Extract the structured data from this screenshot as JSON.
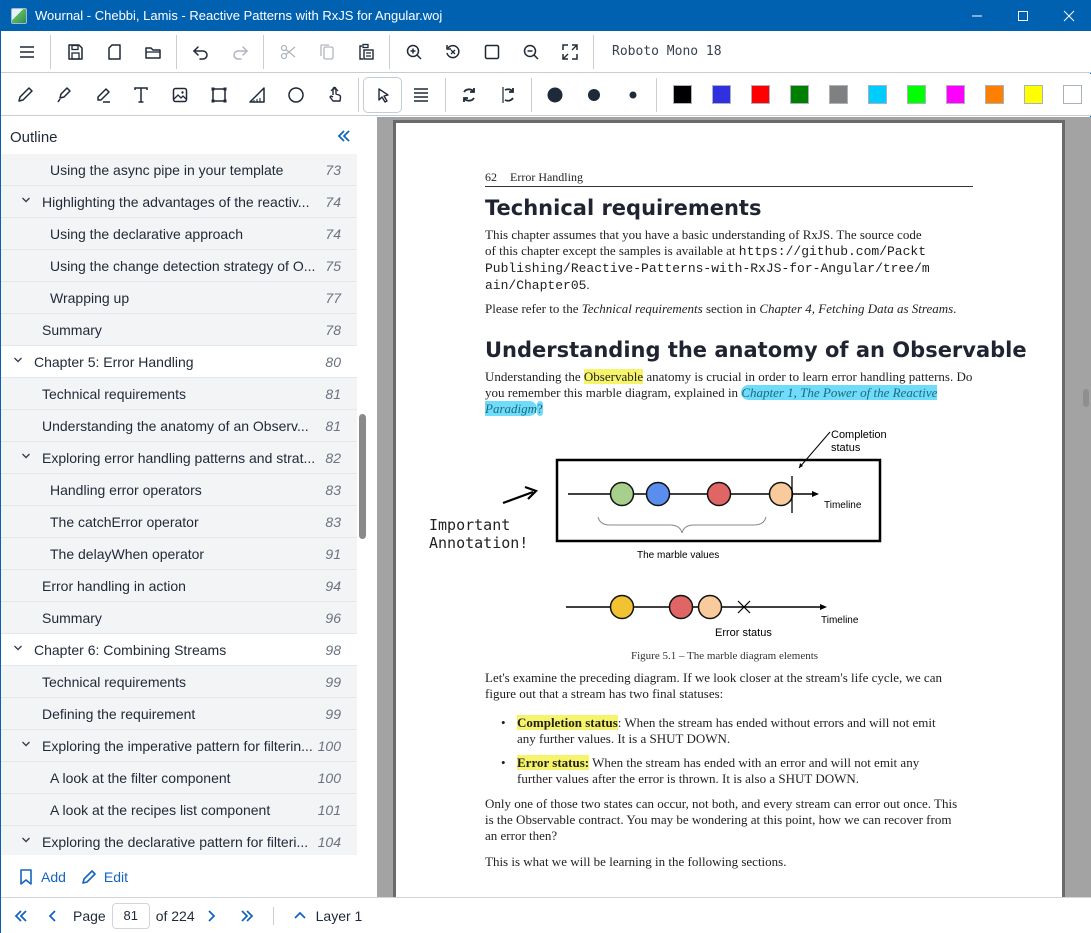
{
  "window": {
    "title": "Wournal - Chebbi, Lamis - Reactive Patterns with RxJS for Angular.woj",
    "controls": [
      "minimize",
      "maximize",
      "close"
    ]
  },
  "toolbar1": {
    "buttons": [
      "menu-icon",
      "save-icon",
      "new-page-icon",
      "open-folder-icon",
      "undo-icon",
      "redo-icon",
      "cut-icon",
      "copy-icon",
      "paste-icon",
      "zoom-in-icon",
      "reset-zoom-icon",
      "fit-page-icon",
      "zoom-out-icon",
      "fullscreen-icon"
    ],
    "font_label": "Roboto Mono 18"
  },
  "toolbar2": {
    "tools": [
      "pen",
      "highlighter",
      "eraser",
      "text",
      "image",
      "select-rectangle",
      "ruler",
      "ellipse",
      "touch-drawing",
      "select-pointer",
      "line-spacing",
      "rotate",
      "rotate-page"
    ],
    "active_tool": "select-pointer",
    "stroke_sizes": [
      "large",
      "medium",
      "small"
    ],
    "colors": [
      "#000000",
      "#3030e0",
      "#ff0000",
      "#008000",
      "#808080",
      "#00ccff",
      "#00ff00",
      "#ff00ff",
      "#ff7f00",
      "#ffff00",
      "#ffffff"
    ]
  },
  "sidebar": {
    "title": "Outline",
    "collapse_label": "«",
    "items": [
      {
        "label": "Using the async pipe in your template",
        "page": "73",
        "level": 3,
        "expandable": false
      },
      {
        "label": "Highlighting the advantages of the reactiv...",
        "page": "74",
        "level": 2,
        "expandable": true
      },
      {
        "label": "Using the declarative approach",
        "page": "74",
        "level": 3,
        "expandable": false
      },
      {
        "label": "Using the change detection strategy of O...",
        "page": "75",
        "level": 3,
        "expandable": false
      },
      {
        "label": "Wrapping up",
        "page": "77",
        "level": 3,
        "expandable": false
      },
      {
        "label": "Summary",
        "page": "78",
        "level": 2,
        "expandable": false
      },
      {
        "label": "Chapter 5: Error Handling",
        "page": "80",
        "level": 1,
        "expandable": true
      },
      {
        "label": "Technical requirements",
        "page": "81",
        "level": 2,
        "expandable": false
      },
      {
        "label": "Understanding the anatomy of an Observ...",
        "page": "81",
        "level": 2,
        "expandable": false
      },
      {
        "label": "Exploring error handling patterns and strat...",
        "page": "82",
        "level": 2,
        "expandable": true
      },
      {
        "label": "Handling error operators",
        "page": "83",
        "level": 3,
        "expandable": false
      },
      {
        "label": "The catchError operator",
        "page": "83",
        "level": 3,
        "expandable": false
      },
      {
        "label": "The delayWhen operator",
        "page": "91",
        "level": 3,
        "expandable": false
      },
      {
        "label": "Error handling in action",
        "page": "94",
        "level": 2,
        "expandable": false
      },
      {
        "label": "Summary",
        "page": "96",
        "level": 2,
        "expandable": false
      },
      {
        "label": "Chapter 6: Combining Streams",
        "page": "98",
        "level": 1,
        "expandable": true
      },
      {
        "label": "Technical requirements",
        "page": "99",
        "level": 2,
        "expandable": false
      },
      {
        "label": "Defining the requirement",
        "page": "99",
        "level": 2,
        "expandable": false
      },
      {
        "label": "Exploring the imperative pattern for filterin...",
        "page": "100",
        "level": 2,
        "expandable": true
      },
      {
        "label": "A look at the filter component",
        "page": "100",
        "level": 3,
        "expandable": false
      },
      {
        "label": "A look at the recipes list component",
        "page": "101",
        "level": 3,
        "expandable": false
      },
      {
        "label": "Exploring the declarative pattern for filteri...",
        "page": "104",
        "level": 2,
        "expandable": true
      }
    ],
    "add_label": "Add",
    "edit_label": "Edit"
  },
  "document": {
    "running_head_number": "62",
    "running_head_title": "Error Handling",
    "section1_title": "Technical requirements",
    "section1_p1_a": "This chapter assumes that you have a basic understanding of RxJS. The source code of this chapter except the samples is available at ",
    "section1_p1_url": "https://github.com/PacktPublishing/Reactive-Patterns-with-RxJS-for-Angular/tree/main/Chapter05",
    "section1_p1_b": ".",
    "section1_p2_a": "Please refer to the ",
    "section1_p2_i1": "Technical requirements",
    "section1_p2_b": " section in ",
    "section1_p2_i2": "Chapter 4, Fetching Data as Streams",
    "section1_p2_c": ".",
    "section2_title": "Understanding the anatomy of an Observable",
    "section2_p1_a": "Understanding the ",
    "section2_p1_hl": "Observable",
    "section2_p1_b": " anatomy is crucial in order to learn error handling patterns. Do you remember this marble diagram, explained in ",
    "section2_p1_link": "Chapter 1, The Power of the Reactive Paradigm",
    "section2_p1_c": "?",
    "figure": {
      "completion_label_1": "Completion",
      "completion_label_2": "status",
      "timeline_label": "Timeline",
      "marble_values_label": "The marble values",
      "error_status_label": "Error status",
      "caption": "Figure 5.1 – The marble diagram elements",
      "top_marbles": [
        "#a8d08d",
        "#5b8def",
        "#e06666",
        "#f9cb9c"
      ],
      "bottom_marbles": [
        "#f1c232",
        "#e06666",
        "#f9cb9c"
      ]
    },
    "annotation_line1": "Important",
    "annotation_line2": "Annotation!",
    "section2_p2": "Let's examine the preceding diagram. If we look closer at the stream's life cycle, we can figure out that a stream has two final statuses:",
    "bullet1_term": "Completion status",
    "bullet1_text": ": When the stream has ended without errors and will not emit any further values. It is a SHUT DOWN.",
    "bullet2_term": "Error status:",
    "bullet2_text": " When the stream has ended with an error and will not emit any further values after the error is thrown. It is also a SHUT DOWN.",
    "section2_p3": "Only one of those two states can occur, not both, and every stream can error out once. This is the Observable contract. You may be wondering at this point, how we can recover from an error then?",
    "section2_p4": "This is what we will be learning in the following sections."
  },
  "statusbar": {
    "page_label": "Page",
    "current_page": "81",
    "of_label": "of 224",
    "layer_label": "Layer 1"
  }
}
